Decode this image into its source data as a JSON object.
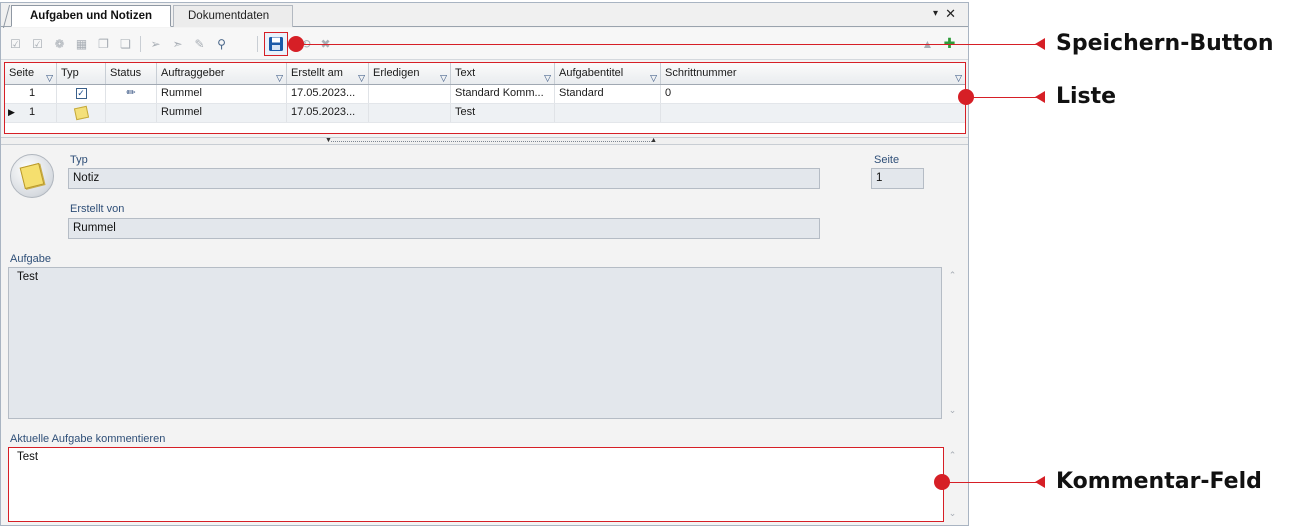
{
  "tabs": [
    {
      "label": "Aufgaben und Notizen",
      "active": true
    },
    {
      "label": "Dokumentdaten",
      "active": false
    }
  ],
  "window_controls": {
    "menu_glyph": "▾",
    "close_glyph": "✕"
  },
  "toolbar": {
    "icons": [
      "check-icon",
      "check-all-icon",
      "tag-icon",
      "date-icon",
      "copy-icon",
      "copy-forward-icon",
      "export-icon",
      "import-icon",
      "edit-icon",
      "preview-icon",
      "save-icon",
      "undo-icon",
      "delete-icon",
      "collapse-icon",
      "add-icon"
    ]
  },
  "grid": {
    "columns": [
      "Seite",
      "Typ",
      "Status",
      "Auftraggeber",
      "Erstellt am",
      "Erledigen",
      "Text",
      "Aufgabentitel",
      "Schrittnummer"
    ],
    "rows": [
      {
        "seite": "1",
        "typ": "task-checkbox-icon",
        "status": "pencil-icon",
        "auftraggeber": "Rummel",
        "erstellt_am": "17.05.2023...",
        "erledigen": "",
        "text": "Standard Komm...",
        "aufgabentitel": "Standard",
        "schrittnummer": "0",
        "selected": false
      },
      {
        "seite": "1",
        "typ": "note-icon",
        "status": "",
        "auftraggeber": "Rummel",
        "erstellt_am": "17.05.2023...",
        "erledigen": "",
        "text": "Test",
        "aufgabentitel": "",
        "schrittnummer": "",
        "selected": true
      }
    ]
  },
  "detail": {
    "typ_label": "Typ",
    "typ_value": "Notiz",
    "seite_label": "Seite",
    "seite_value": "1",
    "erstellt_von_label": "Erstellt von",
    "erstellt_von_value": "Rummel",
    "aufgabe_label": "Aufgabe",
    "aufgabe_value": "Test",
    "kommentar_label": "Aktuelle Aufgabe kommentieren",
    "kommentar_value": "Test"
  },
  "callouts": {
    "speichern": "Speichern-Button",
    "liste": "Liste",
    "kommentar": "Kommentar-Feld"
  },
  "colors": {
    "callout_red": "#d61f26",
    "save_blue": "#1b5aa8"
  }
}
